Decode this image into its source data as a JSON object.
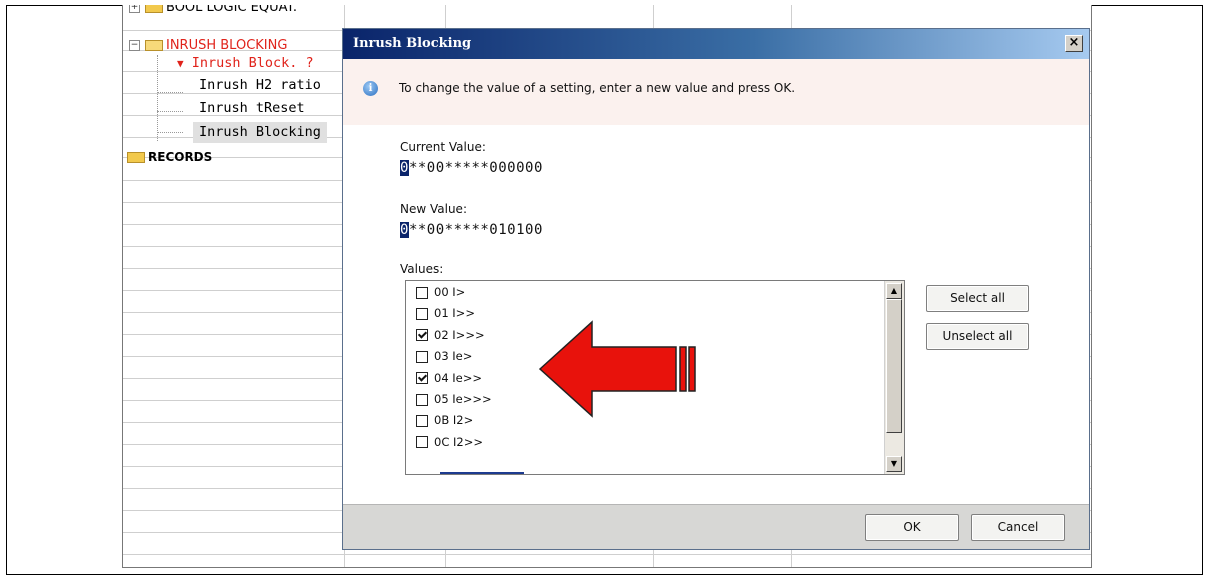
{
  "tree": {
    "items": [
      {
        "label": "BOOL LOGIC EQUAT."
      },
      {
        "label": "INRUSH BLOCKING"
      },
      {
        "label": "Inrush Block. ?"
      },
      {
        "label": "Inrush H2 ratio"
      },
      {
        "label": "Inrush tReset"
      },
      {
        "label": "Inrush Blocking"
      },
      {
        "label": "RECORDS"
      }
    ]
  },
  "dialog": {
    "title": "Inrush Blocking",
    "close_label": "×",
    "info_text": "To change the value of a setting, enter a new value and press OK.",
    "current_value_label": "Current Value:",
    "current_value_first": "0",
    "current_value_rest": "**00*****000000",
    "new_value_label": "New Value:",
    "new_value_first": "0",
    "new_value_rest": "**00*****010100",
    "values_label": "Values:",
    "values": [
      {
        "label": "00 I>",
        "checked": false
      },
      {
        "label": "01 I>>",
        "checked": false
      },
      {
        "label": "02 I>>>",
        "checked": true
      },
      {
        "label": "03 Ie>",
        "checked": false
      },
      {
        "label": "04 Ie>>",
        "checked": true
      },
      {
        "label": "05 Ie>>>",
        "checked": false
      },
      {
        "label": "0B I2>",
        "checked": false
      },
      {
        "label": "0C I2>>",
        "checked": false
      }
    ],
    "select_all_label": "Select all",
    "unselect_all_label": "Unselect all",
    "ok_label": "OK",
    "cancel_label": "Cancel"
  },
  "colors": {
    "title_bar": "#0a246a",
    "tree_red": "#e0231b",
    "arrow_fill": "#e8120c"
  },
  "icons": [
    "folder-icon",
    "info-icon",
    "checkbox-icon",
    "red-arrow-icon",
    "scroll-up-icon",
    "scroll-down-icon"
  ]
}
